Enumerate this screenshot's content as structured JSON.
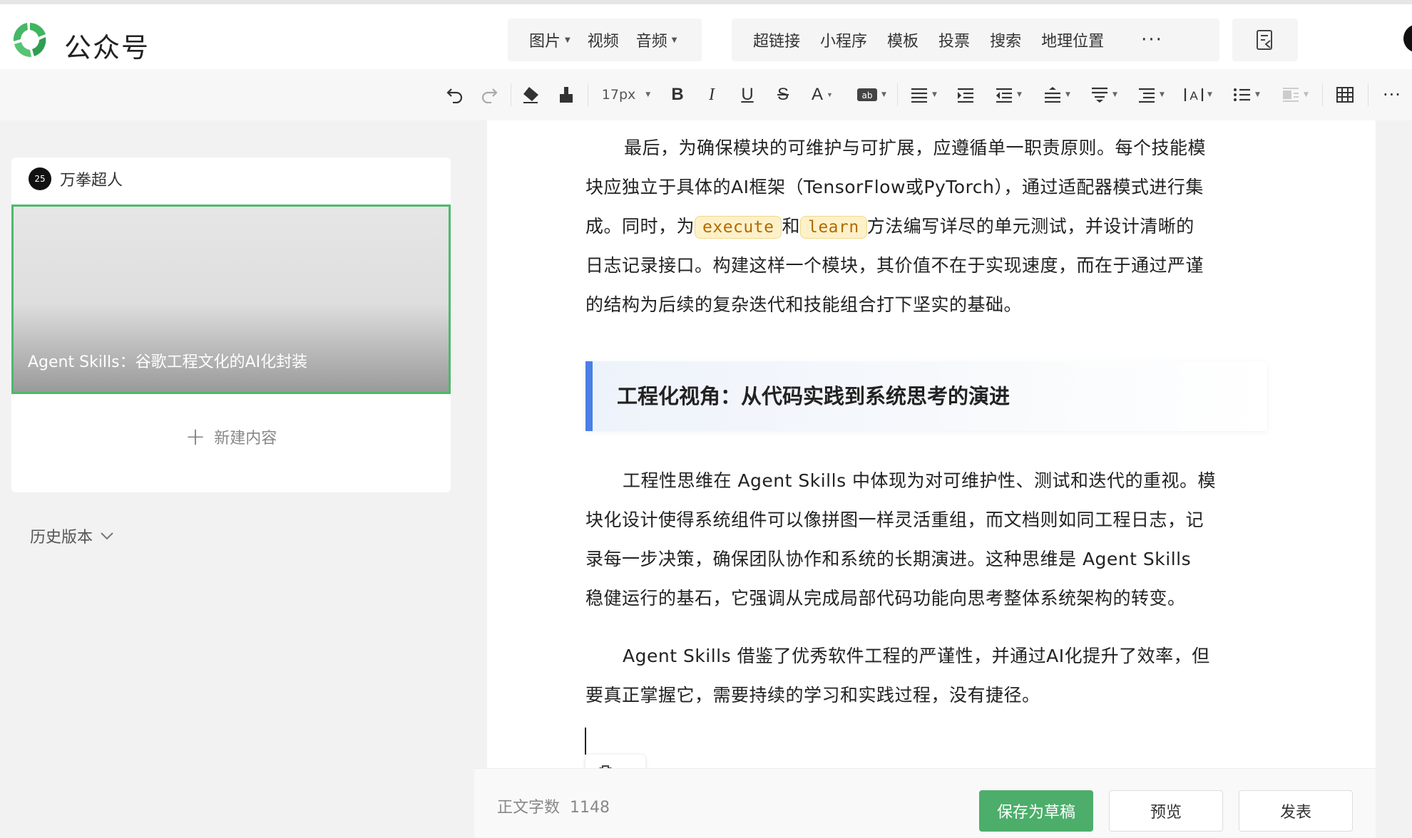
{
  "app": {
    "brand": "公众号"
  },
  "insert_menu": {
    "group1": [
      {
        "label": "图片",
        "has_caret": true
      },
      {
        "label": "视频",
        "has_caret": false
      },
      {
        "label": "音频",
        "has_caret": true
      }
    ],
    "group2": [
      {
        "label": "超链接"
      },
      {
        "label": "小程序"
      },
      {
        "label": "模板"
      },
      {
        "label": "投票"
      },
      {
        "label": "搜索"
      },
      {
        "label": "地理位置"
      }
    ],
    "more": "···"
  },
  "toolbar": {
    "font_size": "17px"
  },
  "left_panel": {
    "account_name": "万拳超人",
    "avatar_text": "25",
    "article_title": "Agent Skills：谷歌工程文化的AI化封装",
    "new_content": "新建内容",
    "history": "历史版本"
  },
  "editor": {
    "para1": {
      "l1": "最后，为确保模块的可维护与可扩展，应遵循单一职责原则。每个技能模",
      "l2": "块应独立于具体的AI框架（TensorFlow或PyTorch），通过适配器模式进行集",
      "l3_pre": "成。同时，为",
      "code1": "execute",
      "l3_mid": "和",
      "code2": "learn",
      "l3_post": "方法编写详尽的单元测试，并设计清晰的",
      "l4": "日志记录接口。构建这样一个模块，其价值不在于实现速度，而在于通过严谨",
      "l5": "的结构为后续的复杂迭代和技能组合打下坚实的基础。"
    },
    "heading": "工程化视角：从代码实践到系统思考的演进",
    "para2": {
      "l1": "工程性思维在 Agent Skills 中体现为对可维护性、测试和迭代的重视。模",
      "l2": "块化设计使得系统组件可以像拼图一样灵活重组，而文档则如同工程日志，记",
      "l3": "录每一步决策，确保团队协作和系统的长期演进。这种思维是 Agent Skills",
      "l4": "稳健运行的基石，它强调从完成局部代码功能向思考整体系统架构的转变。"
    },
    "para3": {
      "l1": "Agent Skills 借鉴了优秀软件工程的严谨性，并通过AI化提升了效率，但",
      "l2": "要真正掌握它，需要持续的学习和实践过程，没有捷径。"
    }
  },
  "footer": {
    "word_count_label": "正文字数",
    "word_count": "1148",
    "save_draft": "保存为草稿",
    "preview": "预览",
    "publish": "发表"
  },
  "colors": {
    "brand_green": "#4cae6a",
    "heading_bar": "#4a7fe5",
    "code_bg": "#fdf1c9"
  }
}
